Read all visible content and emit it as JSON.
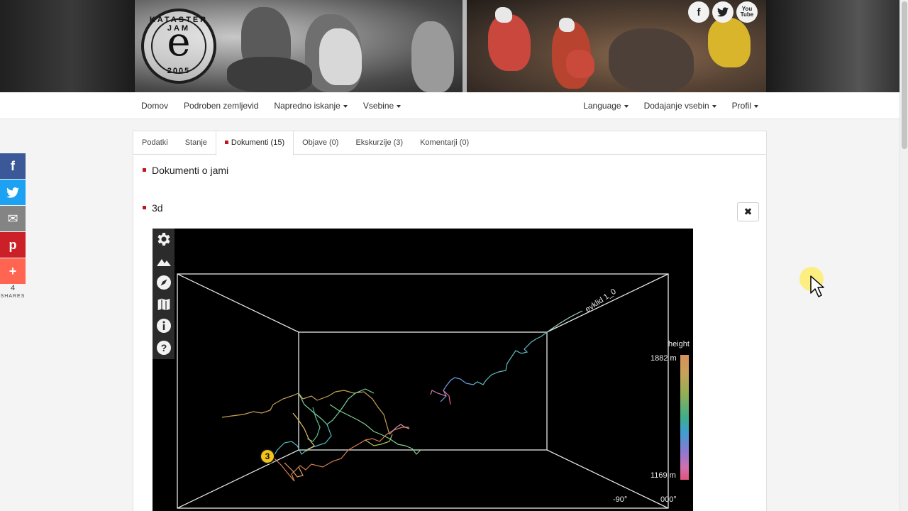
{
  "header": {
    "logo": {
      "top_text": "KATASTER JAM",
      "letter": "e",
      "year": "2005"
    },
    "social": [
      {
        "name": "facebook",
        "glyph": "f"
      },
      {
        "name": "twitter",
        "glyph": "t"
      },
      {
        "name": "youtube",
        "glyph": "You\nTube"
      }
    ]
  },
  "nav": {
    "left": [
      {
        "label": "Domov",
        "dropdown": false
      },
      {
        "label": "Podroben zemljevid",
        "dropdown": false
      },
      {
        "label": "Napredno iskanje",
        "dropdown": true
      },
      {
        "label": "Vsebine",
        "dropdown": true
      }
    ],
    "right": [
      {
        "label": "Language",
        "dropdown": true
      },
      {
        "label": "Dodajanje vsebin",
        "dropdown": true
      },
      {
        "label": "Profil",
        "dropdown": true
      }
    ]
  },
  "tabs": [
    {
      "label": "Podatki",
      "active": false
    },
    {
      "label": "Stanje",
      "active": false
    },
    {
      "label": "Dokumenti (15)",
      "active": true
    },
    {
      "label": "Objave (0)",
      "active": false
    },
    {
      "label": "Ekskurzije (3)",
      "active": false
    },
    {
      "label": "Komentarji (0)",
      "active": false
    }
  ],
  "content": {
    "section_title": "Dokumenti o jami",
    "document_title": "3d",
    "close_glyph": "✖"
  },
  "viewer": {
    "survey_label": "evklid 1_0",
    "legend_title": "height",
    "legend_max": "1882 m",
    "legend_min": "1169 m",
    "entrance_marker": "3",
    "tilt_label": "-90°",
    "heading_label": "000°",
    "tools": [
      "settings-icon",
      "terrain-icon",
      "compass-icon",
      "map-icon",
      "info-icon",
      "help-icon"
    ]
  },
  "share": {
    "buttons": [
      {
        "name": "facebook",
        "glyph": "f",
        "color": "#3b5998"
      },
      {
        "name": "twitter",
        "glyph": "t",
        "color": "#1da1f2"
      },
      {
        "name": "email",
        "glyph": "✉",
        "color": "#848484"
      },
      {
        "name": "pinterest",
        "glyph": "p",
        "color": "#cb2027"
      },
      {
        "name": "more",
        "glyph": "+",
        "color": "#ff6550"
      }
    ],
    "count": "4",
    "label": "SHARES"
  },
  "colors": {
    "accent": "#c0151a"
  }
}
